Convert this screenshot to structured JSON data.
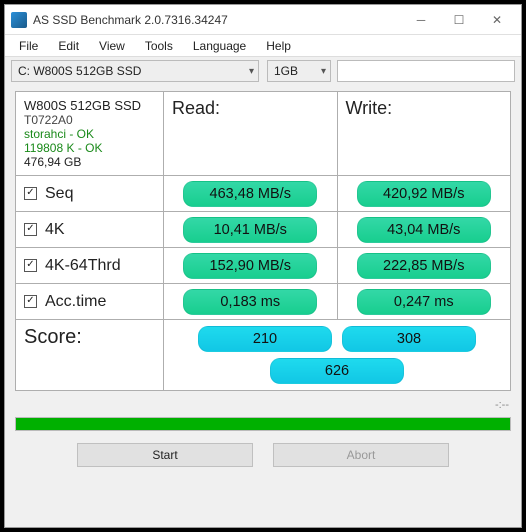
{
  "title": "AS SSD Benchmark 2.0.7316.34247",
  "menu": {
    "file": "File",
    "edit": "Edit",
    "view": "View",
    "tools": "Tools",
    "language": "Language",
    "help": "Help"
  },
  "toolbar": {
    "drive": "C: W800S 512GB SSD",
    "size": "1GB"
  },
  "drive": {
    "name": "W800S 512GB SSD",
    "model": "T0722A0",
    "driver_ok": "storahci - OK",
    "align_ok": "119808 K - OK",
    "capacity": "476,94 GB"
  },
  "headers": {
    "read": "Read:",
    "write": "Write:",
    "score": "Score:"
  },
  "tests": {
    "seq": {
      "label": "Seq",
      "read": "463,48 MB/s",
      "write": "420,92 MB/s"
    },
    "fk": {
      "label": "4K",
      "read": "10,41 MB/s",
      "write": "43,04 MB/s"
    },
    "fk64": {
      "label": "4K-64Thrd",
      "read": "152,90 MB/s",
      "write": "222,85 MB/s"
    },
    "acc": {
      "label": "Acc.time",
      "read": "0,183 ms",
      "write": "0,247 ms"
    }
  },
  "score": {
    "read": "210",
    "write": "308",
    "total": "626"
  },
  "status": "-:--",
  "buttons": {
    "start": "Start",
    "abort": "Abort"
  },
  "chart_data": {
    "type": "table",
    "title": "AS SSD Benchmark",
    "drive": "W800S 512GB SSD",
    "capacity_gb": 476.94,
    "tests": [
      {
        "name": "Seq",
        "read_MBps": 463.48,
        "write_MBps": 420.92
      },
      {
        "name": "4K",
        "read_MBps": 10.41,
        "write_MBps": 43.04
      },
      {
        "name": "4K-64Thrd",
        "read_MBps": 152.9,
        "write_MBps": 222.85
      },
      {
        "name": "Acc.time",
        "read_ms": 0.183,
        "write_ms": 0.247
      }
    ],
    "score": {
      "read": 210,
      "write": 308,
      "total": 626
    }
  }
}
